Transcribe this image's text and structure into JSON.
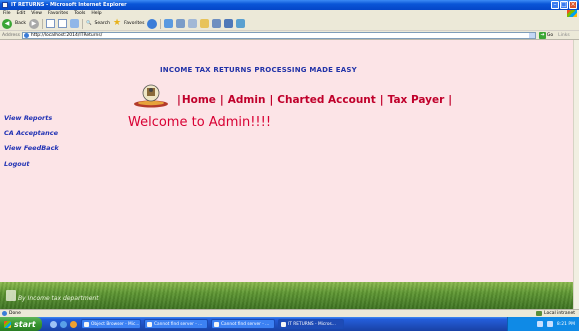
{
  "window": {
    "title": "IT RETURNS - Microsoft Internet Explorer"
  },
  "menu": [
    "File",
    "Edit",
    "View",
    "Favorites",
    "Tools",
    "Help"
  ],
  "toolbar": {
    "back_label": "Back",
    "search_label": "Search",
    "favorites_label": "Favorites"
  },
  "address": {
    "label": "Address",
    "url": "http://localhost:2014/ITReturns/",
    "go_label": "Go",
    "links_label": "Links"
  },
  "page": {
    "heading": "INCOME TAX RETURNS PROCESSING MADE EASY",
    "nav": [
      {
        "label": "Home"
      },
      {
        "label": "Admin"
      },
      {
        "label": "Charted Account"
      },
      {
        "label": "Tax Payer"
      }
    ],
    "welcome": "Welcome to Admin!!!!",
    "sidebar": [
      {
        "label": "View Reports"
      },
      {
        "label": "CA Acceptance"
      },
      {
        "label": "View FeedBack"
      },
      {
        "label": "Logout"
      }
    ],
    "footer": "By Income tax department"
  },
  "status": {
    "text": "Done",
    "zone": "Local intranet"
  },
  "taskbar": {
    "start_label": "start",
    "tasks": [
      {
        "label": "Object Browser - Mic..."
      },
      {
        "label": "Cannot find server - ..."
      },
      {
        "label": "Cannot find server - ..."
      },
      {
        "label": "IT RETURNS - Micros..."
      }
    ],
    "clock": "8:21 PM"
  },
  "colors": {
    "nav_red": "#c0002b",
    "heading_blue": "#2233a8",
    "page_bg": "#fce4e7"
  }
}
